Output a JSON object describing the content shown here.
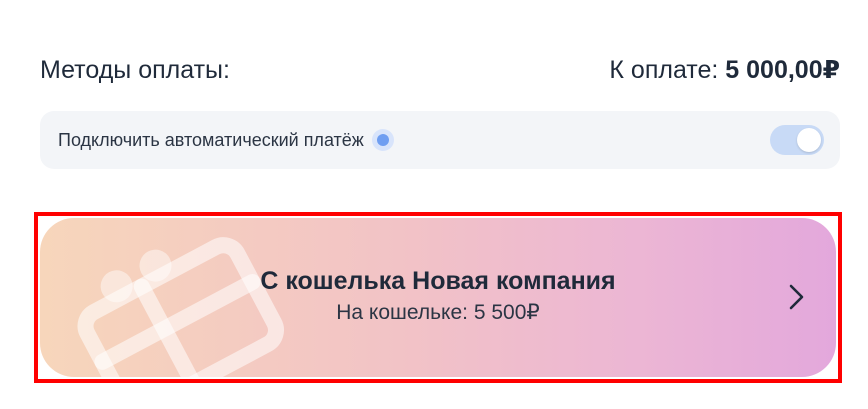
{
  "header": {
    "title": "Методы оплаты:",
    "total_label": "К оплате:",
    "total_amount": "5 000,00₽"
  },
  "auto_payment": {
    "label": "Подключить автоматический платёж",
    "info_icon": "info-dot-icon",
    "toggle_on": true
  },
  "wallet": {
    "title": "С кошелька Новая компания",
    "balance_text": "На кошельке: 5 500₽",
    "illustration_icon": "gift-card-icon",
    "arrow_icon": "chevron-right-icon"
  },
  "colors": {
    "highlight": "#ff0000",
    "toggle_track": "#c8daf6",
    "info_dot": "#6f9ef1",
    "gradient_start": "#f7d6bb",
    "gradient_end": "#e3a8dc"
  }
}
